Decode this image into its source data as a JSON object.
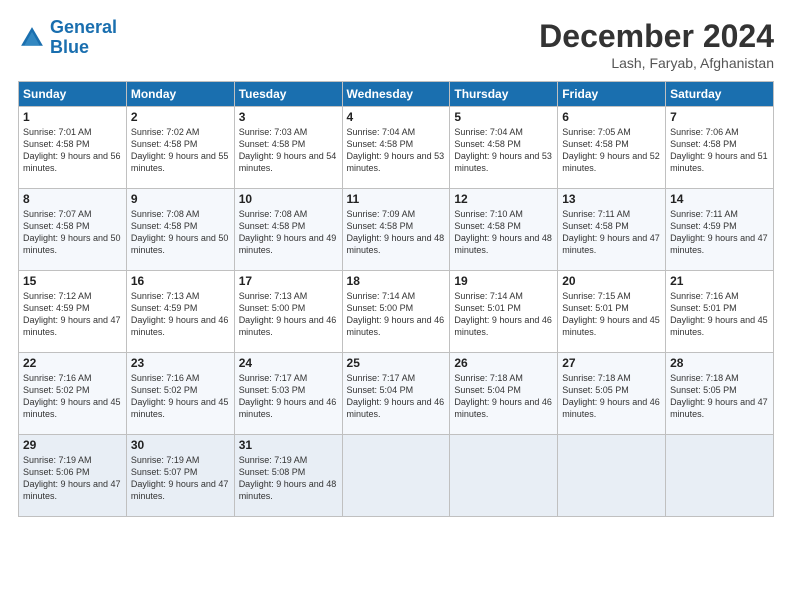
{
  "header": {
    "logo_line1": "General",
    "logo_line2": "Blue",
    "month": "December 2024",
    "location": "Lash, Faryab, Afghanistan"
  },
  "weekdays": [
    "Sunday",
    "Monday",
    "Tuesday",
    "Wednesday",
    "Thursday",
    "Friday",
    "Saturday"
  ],
  "weeks": [
    [
      {
        "day": "1",
        "sunrise": "Sunrise: 7:01 AM",
        "sunset": "Sunset: 4:58 PM",
        "daylight": "Daylight: 9 hours and 56 minutes."
      },
      {
        "day": "2",
        "sunrise": "Sunrise: 7:02 AM",
        "sunset": "Sunset: 4:58 PM",
        "daylight": "Daylight: 9 hours and 55 minutes."
      },
      {
        "day": "3",
        "sunrise": "Sunrise: 7:03 AM",
        "sunset": "Sunset: 4:58 PM",
        "daylight": "Daylight: 9 hours and 54 minutes."
      },
      {
        "day": "4",
        "sunrise": "Sunrise: 7:04 AM",
        "sunset": "Sunset: 4:58 PM",
        "daylight": "Daylight: 9 hours and 53 minutes."
      },
      {
        "day": "5",
        "sunrise": "Sunrise: 7:04 AM",
        "sunset": "Sunset: 4:58 PM",
        "daylight": "Daylight: 9 hours and 53 minutes."
      },
      {
        "day": "6",
        "sunrise": "Sunrise: 7:05 AM",
        "sunset": "Sunset: 4:58 PM",
        "daylight": "Daylight: 9 hours and 52 minutes."
      },
      {
        "day": "7",
        "sunrise": "Sunrise: 7:06 AM",
        "sunset": "Sunset: 4:58 PM",
        "daylight": "Daylight: 9 hours and 51 minutes."
      }
    ],
    [
      {
        "day": "8",
        "sunrise": "Sunrise: 7:07 AM",
        "sunset": "Sunset: 4:58 PM",
        "daylight": "Daylight: 9 hours and 50 minutes."
      },
      {
        "day": "9",
        "sunrise": "Sunrise: 7:08 AM",
        "sunset": "Sunset: 4:58 PM",
        "daylight": "Daylight: 9 hours and 50 minutes."
      },
      {
        "day": "10",
        "sunrise": "Sunrise: 7:08 AM",
        "sunset": "Sunset: 4:58 PM",
        "daylight": "Daylight: 9 hours and 49 minutes."
      },
      {
        "day": "11",
        "sunrise": "Sunrise: 7:09 AM",
        "sunset": "Sunset: 4:58 PM",
        "daylight": "Daylight: 9 hours and 48 minutes."
      },
      {
        "day": "12",
        "sunrise": "Sunrise: 7:10 AM",
        "sunset": "Sunset: 4:58 PM",
        "daylight": "Daylight: 9 hours and 48 minutes."
      },
      {
        "day": "13",
        "sunrise": "Sunrise: 7:11 AM",
        "sunset": "Sunset: 4:58 PM",
        "daylight": "Daylight: 9 hours and 47 minutes."
      },
      {
        "day": "14",
        "sunrise": "Sunrise: 7:11 AM",
        "sunset": "Sunset: 4:59 PM",
        "daylight": "Daylight: 9 hours and 47 minutes."
      }
    ],
    [
      {
        "day": "15",
        "sunrise": "Sunrise: 7:12 AM",
        "sunset": "Sunset: 4:59 PM",
        "daylight": "Daylight: 9 hours and 47 minutes."
      },
      {
        "day": "16",
        "sunrise": "Sunrise: 7:13 AM",
        "sunset": "Sunset: 4:59 PM",
        "daylight": "Daylight: 9 hours and 46 minutes."
      },
      {
        "day": "17",
        "sunrise": "Sunrise: 7:13 AM",
        "sunset": "Sunset: 5:00 PM",
        "daylight": "Daylight: 9 hours and 46 minutes."
      },
      {
        "day": "18",
        "sunrise": "Sunrise: 7:14 AM",
        "sunset": "Sunset: 5:00 PM",
        "daylight": "Daylight: 9 hours and 46 minutes."
      },
      {
        "day": "19",
        "sunrise": "Sunrise: 7:14 AM",
        "sunset": "Sunset: 5:01 PM",
        "daylight": "Daylight: 9 hours and 46 minutes."
      },
      {
        "day": "20",
        "sunrise": "Sunrise: 7:15 AM",
        "sunset": "Sunset: 5:01 PM",
        "daylight": "Daylight: 9 hours and 45 minutes."
      },
      {
        "day": "21",
        "sunrise": "Sunrise: 7:16 AM",
        "sunset": "Sunset: 5:01 PM",
        "daylight": "Daylight: 9 hours and 45 minutes."
      }
    ],
    [
      {
        "day": "22",
        "sunrise": "Sunrise: 7:16 AM",
        "sunset": "Sunset: 5:02 PM",
        "daylight": "Daylight: 9 hours and 45 minutes."
      },
      {
        "day": "23",
        "sunrise": "Sunrise: 7:16 AM",
        "sunset": "Sunset: 5:02 PM",
        "daylight": "Daylight: 9 hours and 45 minutes."
      },
      {
        "day": "24",
        "sunrise": "Sunrise: 7:17 AM",
        "sunset": "Sunset: 5:03 PM",
        "daylight": "Daylight: 9 hours and 46 minutes."
      },
      {
        "day": "25",
        "sunrise": "Sunrise: 7:17 AM",
        "sunset": "Sunset: 5:04 PM",
        "daylight": "Daylight: 9 hours and 46 minutes."
      },
      {
        "day": "26",
        "sunrise": "Sunrise: 7:18 AM",
        "sunset": "Sunset: 5:04 PM",
        "daylight": "Daylight: 9 hours and 46 minutes."
      },
      {
        "day": "27",
        "sunrise": "Sunrise: 7:18 AM",
        "sunset": "Sunset: 5:05 PM",
        "daylight": "Daylight: 9 hours and 46 minutes."
      },
      {
        "day": "28",
        "sunrise": "Sunrise: 7:18 AM",
        "sunset": "Sunset: 5:05 PM",
        "daylight": "Daylight: 9 hours and 47 minutes."
      }
    ],
    [
      {
        "day": "29",
        "sunrise": "Sunrise: 7:19 AM",
        "sunset": "Sunset: 5:06 PM",
        "daylight": "Daylight: 9 hours and 47 minutes."
      },
      {
        "day": "30",
        "sunrise": "Sunrise: 7:19 AM",
        "sunset": "Sunset: 5:07 PM",
        "daylight": "Daylight: 9 hours and 47 minutes."
      },
      {
        "day": "31",
        "sunrise": "Sunrise: 7:19 AM",
        "sunset": "Sunset: 5:08 PM",
        "daylight": "Daylight: 9 hours and 48 minutes."
      },
      null,
      null,
      null,
      null
    ]
  ]
}
